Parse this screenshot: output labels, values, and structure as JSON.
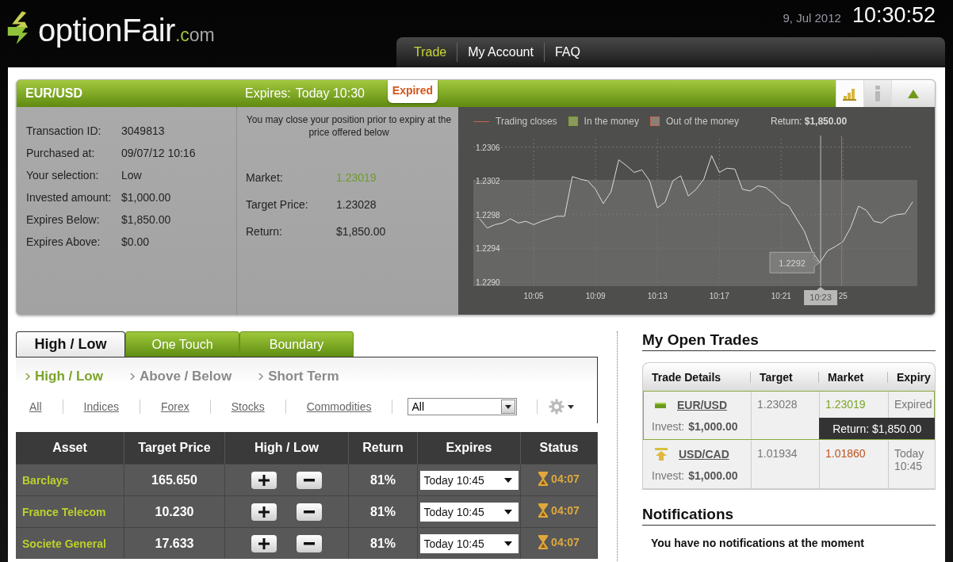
{
  "header": {
    "logo_name": "optionFair",
    "logo_suffix": ".com",
    "date": "9, Jul 2012",
    "time": "10:30:52"
  },
  "nav": [
    {
      "label": "Trade",
      "selected": true
    },
    {
      "label": "My Account",
      "selected": false
    },
    {
      "label": "FAQ",
      "selected": false
    }
  ],
  "trade_card": {
    "asset": "EUR/USD",
    "expires_label": "Expires:",
    "expires_value": "Today 10:30",
    "status": "Expired",
    "view_tabs": [
      {
        "kind": "chart",
        "selected": true
      },
      {
        "kind": "info",
        "selected": false
      }
    ],
    "details": [
      {
        "label": "Transaction ID:",
        "value": "3049813"
      },
      {
        "label": "Purchased at:",
        "value": "09/07/12 10:16"
      },
      {
        "label": "Your selection:",
        "value": "Low"
      },
      {
        "label": "Invested amount:",
        "value": "$1,000.00"
      },
      {
        "label": "Expires Below:",
        "value": "$1,850.00"
      },
      {
        "label": "Expires Above:",
        "value": "$0.00"
      }
    ],
    "close_note": "You may close your position prior to expiry at the price offered below",
    "quote": [
      {
        "label": "Market:",
        "value": "1.23019",
        "kind": "market"
      },
      {
        "label": "Target Price:",
        "value": "1.23028",
        "kind": "plain"
      },
      {
        "label": "Return:",
        "value": "$1,850.00",
        "kind": "plain"
      }
    ],
    "legend": [
      {
        "kind": "line",
        "label": "Trading closes"
      },
      {
        "kind": "in_money",
        "label": "In the money"
      },
      {
        "kind": "out_money",
        "label": "Out of the money"
      }
    ],
    "return_text": "Return: **$1,850.00**",
    "chart_data": {
      "type": "line",
      "categories": [
        null,
        null,
        null,
        null,
        null,
        null,
        null,
        "10:05",
        null,
        null,
        null,
        null,
        null,
        null,
        null,
        "10:09",
        null,
        null,
        null,
        null,
        null,
        null,
        null,
        "10:13",
        null,
        null,
        null,
        null,
        null,
        null,
        null,
        "10:17",
        null,
        null,
        null,
        null,
        null,
        null,
        null,
        "10:21",
        null,
        null,
        null,
        null,
        null,
        null,
        null,
        "25",
        null,
        null,
        null,
        null,
        null,
        null,
        null,
        null,
        null
      ],
      "series": [
        {
          "color": "#dcdcdc",
          "values": [
            1.22975,
            1.22964,
            1.22968,
            1.2297,
            1.22975,
            1.2297,
            1.22972,
            1.22968,
            1.22972,
            1.22975,
            1.22978,
            1.22978,
            1.23025,
            1.23022,
            1.2302,
            1.2301,
            1.22993,
            1.23007,
            1.23045,
            1.23038,
            1.2303,
            1.23033,
            1.2302,
            1.22988,
            1.22995,
            1.2302,
            1.23026,
            1.23002,
            1.2301,
            1.23022,
            1.2305,
            1.2303,
            1.23035,
            1.23034,
            1.2301,
            1.23008,
            1.23014,
            1.23012,
            1.23005,
            1.22995,
            1.2299,
            1.22975,
            1.2296,
            1.22936,
            1.22923,
            1.22937,
            1.22942,
            1.22948,
            1.22965,
            1.2299,
            1.22985,
            1.22972,
            1.2297,
            1.22977,
            1.2298,
            1.22981,
            1.22995
          ]
        }
      ],
      "ylim": [
        1.22895,
        1.2307
      ],
      "grid": true,
      "yticks": [
        {
          "value": 1.2306,
          "label": "1.2306"
        },
        {
          "value": 1.2302,
          "label": "1.2302"
        },
        {
          "value": 1.2298,
          "label": "1.2298"
        },
        {
          "value": 1.2294,
          "label": "1.2294"
        },
        {
          "value": 1.229,
          "label": "1.2290"
        }
      ],
      "bands": [
        {
          "axis": "y",
          "from": 1.22895,
          "to": 1.23021,
          "color": "#666665"
        }
      ],
      "annotations": [
        "1.2292",
        "10:23"
      ]
    }
  },
  "option_tabs": [
    {
      "label": "High / Low",
      "selected": true
    },
    {
      "label": "One Touch",
      "selected": false
    },
    {
      "label": "Boundary",
      "selected": false
    }
  ],
  "sub_tabs": [
    {
      "label": "High / Low",
      "selected": true
    },
    {
      "label": "Above / Below",
      "selected": false
    },
    {
      "label": "Short Term",
      "selected": false
    }
  ],
  "filters": [
    "All",
    "Indices",
    "Forex",
    "Stocks",
    "Commodities"
  ],
  "filter_select": "All",
  "assets_table": {
    "columns": [
      "Asset",
      "Target Price",
      "High / Low",
      "Return",
      "Expires",
      "Status"
    ],
    "rows": [
      {
        "asset": "Barclays",
        "target": "165.650",
        "return": "81%",
        "expires": "Today 10:45",
        "status": "04:07"
      },
      {
        "asset": "France Telecom",
        "target": "10.230",
        "return": "81%",
        "expires": "Today 10:45",
        "status": "04:07"
      },
      {
        "asset": "Societe General",
        "target": "17.633",
        "return": "81%",
        "expires": "Today 10:45",
        "status": "04:07"
      }
    ]
  },
  "open_trades": {
    "title": "My Open Trades",
    "columns": [
      "Trade Details",
      "Target",
      "Market",
      "Expiry"
    ],
    "trades": [
      {
        "kind": "low",
        "pair": "EUR/USD",
        "invest_label": "Invest:",
        "invest": "$1,000.00",
        "target": "1.23028",
        "market": "1.23019",
        "in_the_money": true,
        "expiry": "Expired",
        "return_text": "Return: $1,850.00",
        "selected": true
      },
      {
        "kind": "high",
        "pair": "USD/CAD",
        "invest_label": "Invest:",
        "invest": "$1,000.00",
        "target": "1.01934",
        "market": "1.01860",
        "in_the_money": false,
        "expiry": "Today 10:45",
        "selected": false
      }
    ]
  },
  "notifications": {
    "title": "Notifications",
    "message": "You have no notifications at the moment"
  }
}
